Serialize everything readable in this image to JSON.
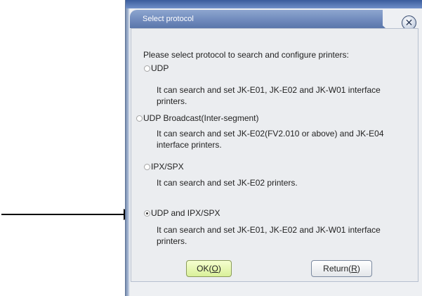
{
  "dialog": {
    "title": "Select protocol",
    "close_symbol": "✕",
    "prompt": "Please select protocol to search and configure printers:",
    "options": [
      {
        "label": "UDP",
        "description_line1": "It can search and set JK-E01, JK-E02 and JK-W01 interface",
        "description_line2": "printers.",
        "selected": false
      },
      {
        "label": "UDP Broadcast(Inter-segment)",
        "description_line1": "It can search and set JK-E02(FV2.010 or above) and JK-E04",
        "description_line2": "interface printers.",
        "selected": false
      },
      {
        "label": "IPX/SPX",
        "description_line1": "It can search and set JK-E02 printers.",
        "description_line2": "",
        "selected": false
      },
      {
        "label": "UDP and IPX/SPX",
        "description_line1": "It can search and set JK-E01, JK-E02 and JK-W01 interface",
        "description_line2": "printers.",
        "selected": true
      }
    ],
    "ok_button": {
      "prefix": "OK(",
      "mnemonic": "O",
      "suffix": ")"
    },
    "return_button": {
      "prefix": "Return(",
      "mnemonic": "R",
      "suffix": ")"
    }
  },
  "annotation": {
    "type": "arrow",
    "points_to": "UDP and IPX/SPX"
  },
  "colors": {
    "title_bar": "#6d88bb",
    "ok_button": "#d9f09a",
    "content_bg": "#ebedf0"
  }
}
